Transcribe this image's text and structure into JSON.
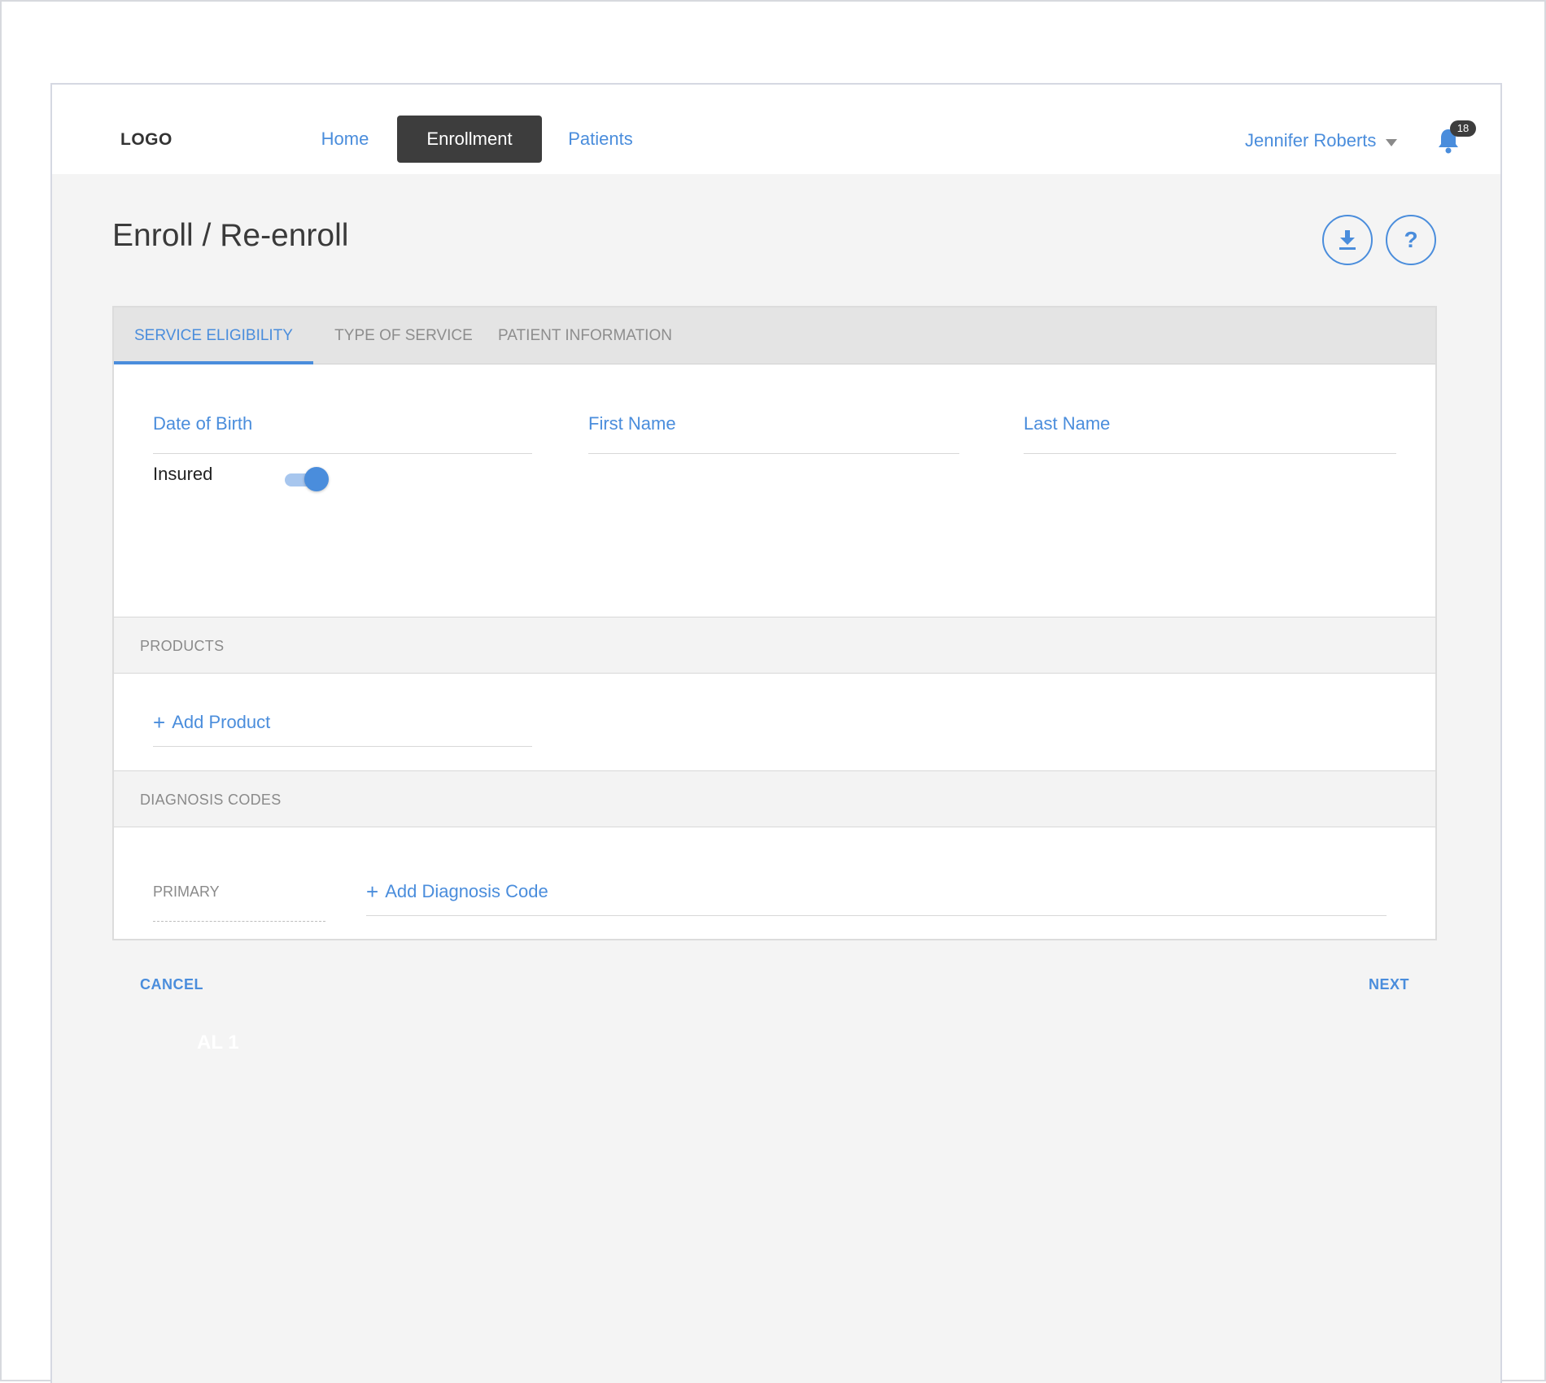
{
  "header": {
    "logo": "LOGO",
    "nav": [
      {
        "label": "Home"
      },
      {
        "label": "Enrollment",
        "active": true
      },
      {
        "label": "Patients"
      }
    ],
    "user_name": "Jennifer Roberts",
    "notification_count": "18"
  },
  "page": {
    "title": "Enroll / Re-enroll",
    "help_symbol": "?"
  },
  "tabs": [
    {
      "label": "SERVICE ELIGIBILITY",
      "active": true
    },
    {
      "label": "TYPE OF SERVICE"
    },
    {
      "label": "PATIENT INFORMATION"
    }
  ],
  "fields": {
    "dob": {
      "label": "Date of Birth",
      "value": ""
    },
    "first_name": {
      "label": "First Name",
      "value": ""
    },
    "last_name": {
      "label": "Last Name",
      "value": ""
    }
  },
  "insured": {
    "label": "Insured",
    "on": true
  },
  "products": {
    "header": "PRODUCTS",
    "add_label": "Add Product"
  },
  "diagnosis": {
    "header": "DIAGNOSIS CODES",
    "primary_label": "PRIMARY",
    "add_label": "Add Diagnosis Code"
  },
  "actions": {
    "cancel": "CANCEL",
    "next": "NEXT"
  },
  "misc": {
    "faint_text": "AL 1"
  },
  "colors": {
    "accent": "#4a8ddc",
    "active_nav_bg": "#3d3d3d"
  }
}
